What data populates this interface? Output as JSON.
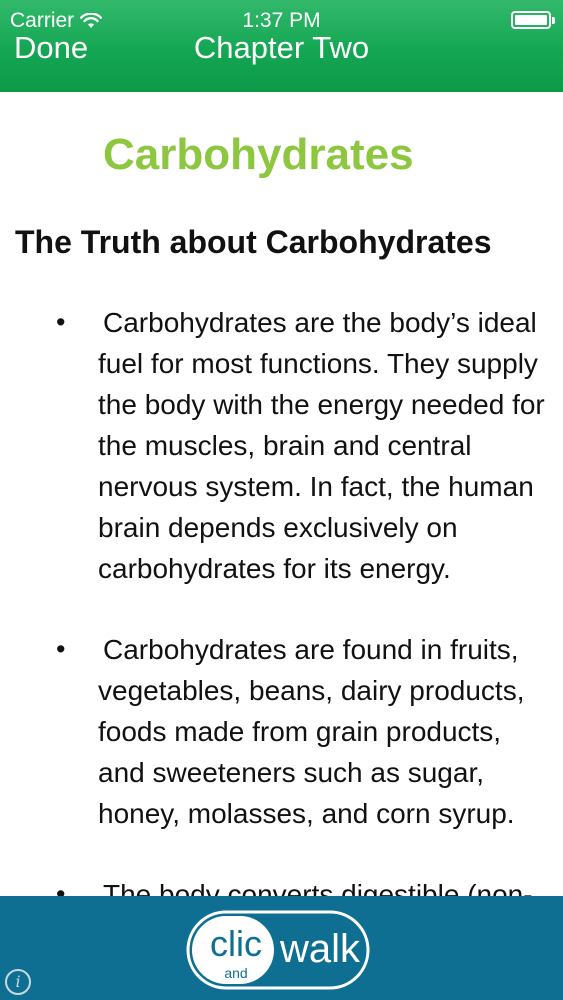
{
  "status_bar": {
    "carrier": "Carrier",
    "time": "1:37 PM"
  },
  "nav": {
    "done_label": "Done",
    "title": "Chapter Two"
  },
  "content": {
    "chapter_title": "Carbohydrates",
    "section_title": "The Truth about Carbohydrates",
    "bullet_symbol": "•",
    "bullets": [
      "Carbohydrates are the body’s ideal fuel for most functions. They supply the body with the energy needed for the muscles, brain and central nervous system. In fact, the human brain depends exclusively on carbohydrates for its energy.",
      "Carbohydrates are found in fruits, vegetables, beans, dairy products, foods made from grain products, and sweeteners such as sugar, honey, molasses, and corn syrup.",
      "The body converts digestible (non-"
    ]
  },
  "footer": {
    "logo": {
      "word1": "clic",
      "word2": "and",
      "word3": "walk"
    },
    "info_icon": "info-icon"
  },
  "colors": {
    "header_green": "#14a653",
    "title_green": "#8dc63f",
    "footer_blue": "#0e6f93"
  }
}
